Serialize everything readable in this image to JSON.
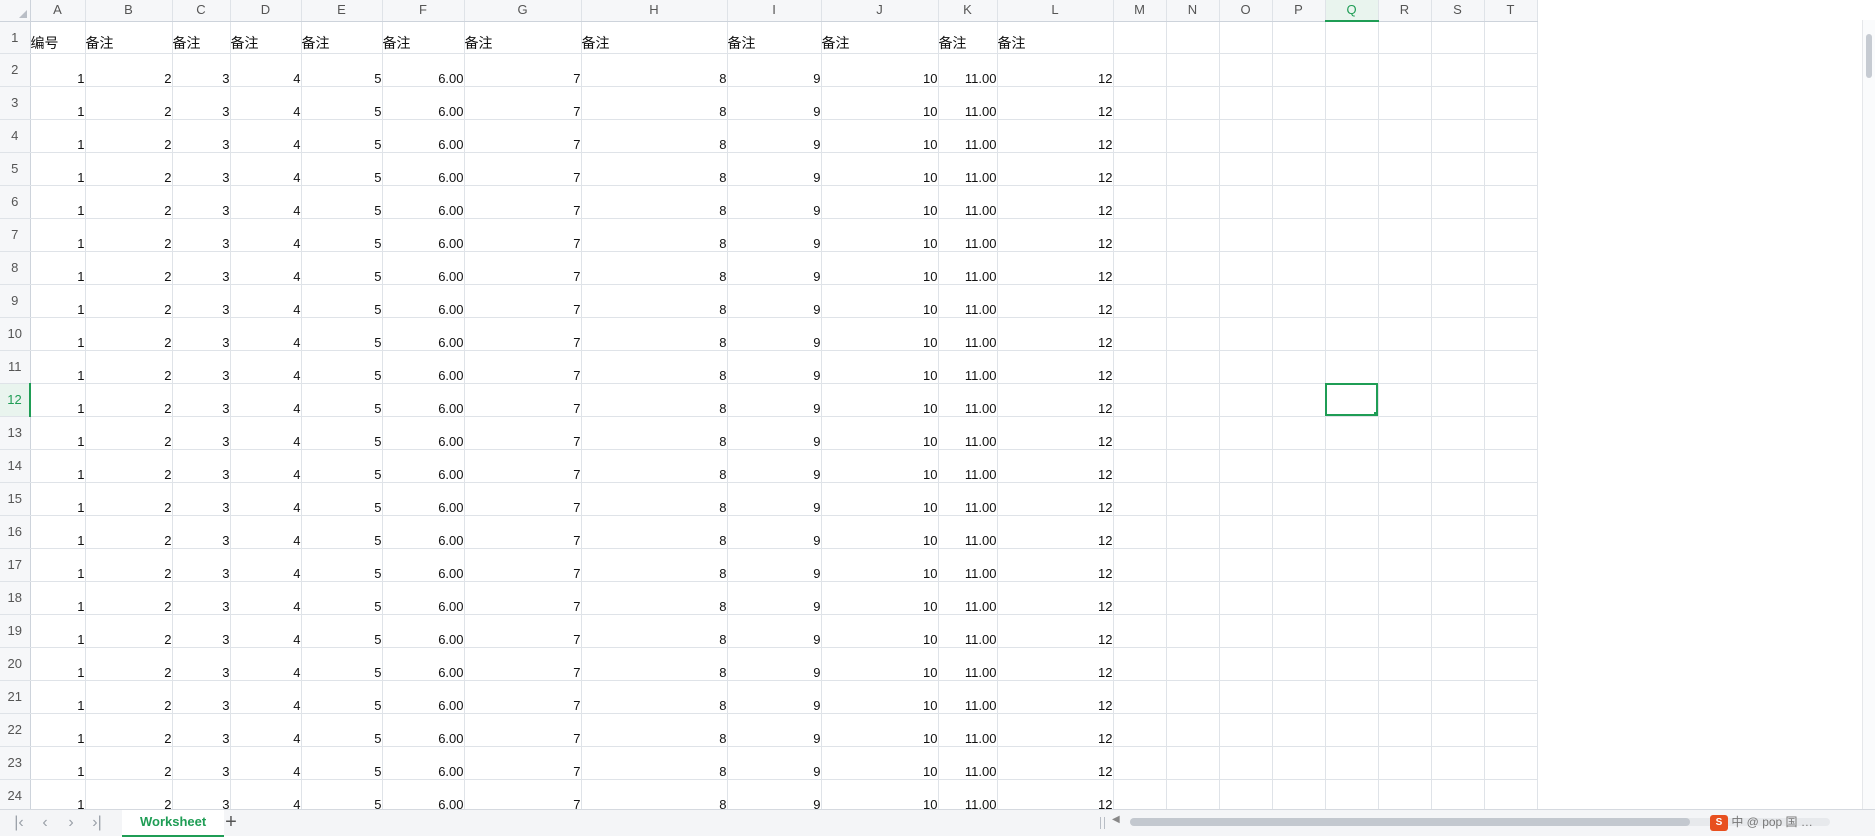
{
  "sheet": {
    "columns": [
      "A",
      "B",
      "C",
      "D",
      "E",
      "F",
      "G",
      "H",
      "I",
      "J",
      "K",
      "L",
      "M",
      "N",
      "O",
      "P",
      "Q",
      "R",
      "S",
      "T"
    ],
    "column_widths_note": "",
    "selected_column": "Q",
    "selected_row": "12",
    "header_row": [
      "编号",
      "备注",
      "备注",
      "备注",
      "备注",
      "备注",
      "备注",
      "备注",
      "备注",
      "备注",
      "备注",
      "备注"
    ],
    "data_row": [
      "1",
      "2",
      "3",
      "4",
      "5",
      "6.00",
      "7",
      "8",
      "9",
      "10",
      "11.00",
      "12"
    ],
    "row_numbers": [
      "1",
      "2",
      "3",
      "4",
      "5",
      "6",
      "7",
      "8",
      "9",
      "10",
      "11",
      "12",
      "13",
      "14",
      "15",
      "16",
      "17",
      "18",
      "19",
      "20",
      "21",
      "22",
      "23",
      "24"
    ]
  },
  "tabs": {
    "active_sheet": "Worksheet",
    "add_label": "+"
  },
  "navigation": {
    "first": "|‹",
    "prev": "‹",
    "next": "›",
    "last": "›|"
  },
  "colors": {
    "accent": "#1f9d55",
    "gridline": "#dfe3e8",
    "header_bg": "#f6f7f9"
  },
  "watermark": {
    "text": "中 @ pop 国 …"
  }
}
